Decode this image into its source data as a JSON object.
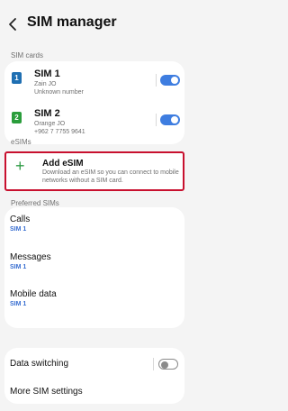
{
  "header": {
    "title": "SIM manager"
  },
  "sections": {
    "sim_cards": "SIM cards",
    "esims": "eSIMs",
    "preferred": "Preferred SIMs"
  },
  "sims": [
    {
      "badge": "1",
      "name": "SIM 1",
      "carrier": "Zain JO",
      "number": "Unknown number",
      "enabled": true,
      "badge_color": "#1f6fb2"
    },
    {
      "badge": "2",
      "name": "SIM 2",
      "carrier": "Orange JO",
      "number": "+962 7 7755 9641",
      "enabled": true,
      "badge_color": "#2a9d3b"
    }
  ],
  "add_esim": {
    "title": "Add eSIM",
    "description": "Download an eSIM so you can connect to mobile networks without a SIM card."
  },
  "preferred": [
    {
      "title": "Calls",
      "value": "SIM 1"
    },
    {
      "title": "Messages",
      "value": "SIM 1"
    },
    {
      "title": "Mobile data",
      "value": "SIM 1"
    }
  ],
  "data_switching": {
    "label": "Data switching",
    "enabled": false
  },
  "more_settings": {
    "label": "More SIM settings"
  },
  "colors": {
    "accent": "#3e7de0",
    "highlight": "#c8102e",
    "add_icon": "#2e9b45"
  }
}
